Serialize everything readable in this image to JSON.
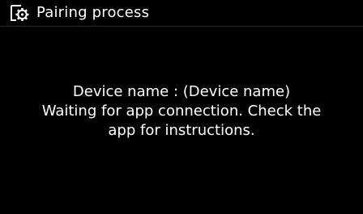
{
  "header": {
    "title": "Pairing process",
    "icon": "settings-gear-icon"
  },
  "message": {
    "line1": "Device name : (Device name)",
    "line2": "Waiting for app connection. Check the",
    "line3": "app for instructions."
  },
  "colors": {
    "background": "#000000",
    "text": "#ffffff"
  }
}
